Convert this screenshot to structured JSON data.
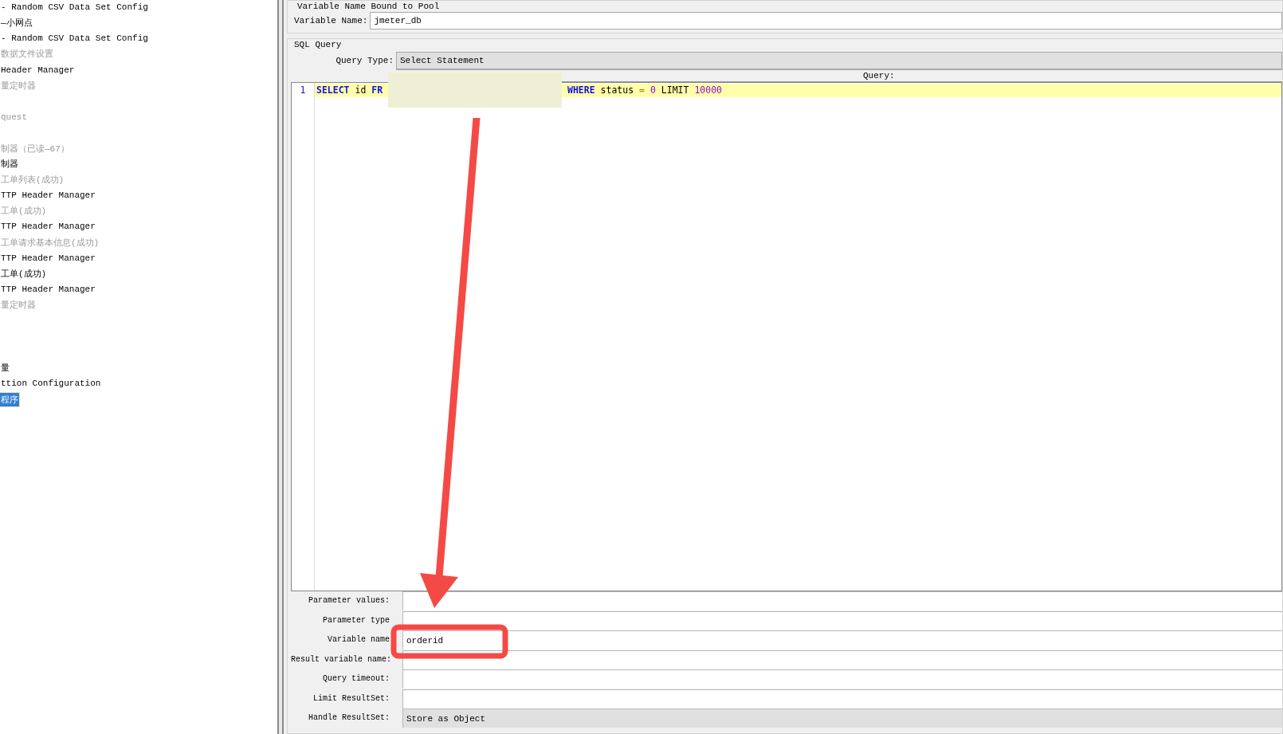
{
  "tree": {
    "items": [
      {
        "kind": "node",
        "label": "- Random CSV Data Set Config",
        "disabled": false,
        "selected": false
      },
      {
        "kind": "node",
        "label": "—小网点",
        "disabled": false,
        "selected": false
      },
      {
        "kind": "node",
        "label": "- Random CSV Data Set Config",
        "disabled": false,
        "selected": false
      },
      {
        "kind": "node",
        "label": "数据文件设置",
        "disabled": true,
        "selected": false
      },
      {
        "kind": "node",
        "label": "Header Manager",
        "disabled": false,
        "selected": false
      },
      {
        "kind": "node",
        "label": "量定时器",
        "disabled": true,
        "selected": false
      },
      {
        "kind": "blank"
      },
      {
        "kind": "node",
        "label": "quest",
        "disabled": true,
        "selected": false
      },
      {
        "kind": "blank"
      },
      {
        "kind": "node",
        "label": "制器（已读—67）",
        "disabled": true,
        "selected": false
      },
      {
        "kind": "node",
        "label": "制器",
        "disabled": false,
        "selected": false
      },
      {
        "kind": "node",
        "label": "工单列表(成功)",
        "disabled": true,
        "selected": false
      },
      {
        "kind": "node",
        "label": "TTP Header Manager",
        "disabled": false,
        "selected": false
      },
      {
        "kind": "node",
        "label": "工单(成功)",
        "disabled": true,
        "selected": false
      },
      {
        "kind": "node",
        "label": "TTP Header Manager",
        "disabled": false,
        "selected": false
      },
      {
        "kind": "node",
        "label": "工单请求基本信息(成功)",
        "disabled": true,
        "selected": false
      },
      {
        "kind": "node",
        "label": "TTP Header Manager",
        "disabled": false,
        "selected": false
      },
      {
        "kind": "node",
        "label": "工单(成功)",
        "disabled": false,
        "selected": false
      },
      {
        "kind": "node",
        "label": "TTP Header Manager",
        "disabled": false,
        "selected": false
      },
      {
        "kind": "node",
        "label": "量定时器",
        "disabled": true,
        "selected": false
      },
      {
        "kind": "blank"
      },
      {
        "kind": "blank"
      },
      {
        "kind": "blank"
      },
      {
        "kind": "node",
        "label": "量",
        "disabled": false,
        "selected": false
      },
      {
        "kind": "node",
        "label": "ttion Configuration",
        "disabled": false,
        "selected": false
      },
      {
        "kind": "node",
        "label": "程序",
        "disabled": false,
        "selected": true
      }
    ]
  },
  "pool": {
    "title": "Variable Name Bound to Pool",
    "label": "Variable Name:",
    "value": "jmeter_db"
  },
  "sql": {
    "title": "SQL Query",
    "query_type": {
      "label": "Query Type:",
      "value": "Select Statement"
    },
    "query_header": "Query:",
    "lines": [
      {
        "number": "1",
        "current": true,
        "tokens": [
          {
            "kind": "keyword",
            "text": "SELECT"
          },
          {
            "kind": "plain",
            "text": "id"
          },
          {
            "kind": "keyword",
            "text": "FR"
          },
          {
            "kind": "redacted"
          },
          {
            "kind": "keyword",
            "text": "WHERE"
          },
          {
            "kind": "plain",
            "text": "status"
          },
          {
            "kind": "operator",
            "text": "="
          },
          {
            "kind": "number",
            "text": "0"
          },
          {
            "kind": "plain",
            "text": "LIMIT"
          },
          {
            "kind": "number",
            "text": "10000"
          }
        ]
      }
    ],
    "params": [
      {
        "kind": "text",
        "label": "Parameter values:"
      },
      {
        "kind": "text",
        "label": "Parameter type"
      },
      {
        "kind": "text",
        "label": "Variable name",
        "value": "orderid"
      },
      {
        "kind": "text",
        "label": "Result variable name:"
      },
      {
        "kind": "text",
        "label": "Query timeout:"
      },
      {
        "kind": "text",
        "label": "Limit ResultSet:"
      },
      {
        "kind": "combo",
        "label": "Handle ResultSet:",
        "value": "Store as Object"
      }
    ]
  }
}
